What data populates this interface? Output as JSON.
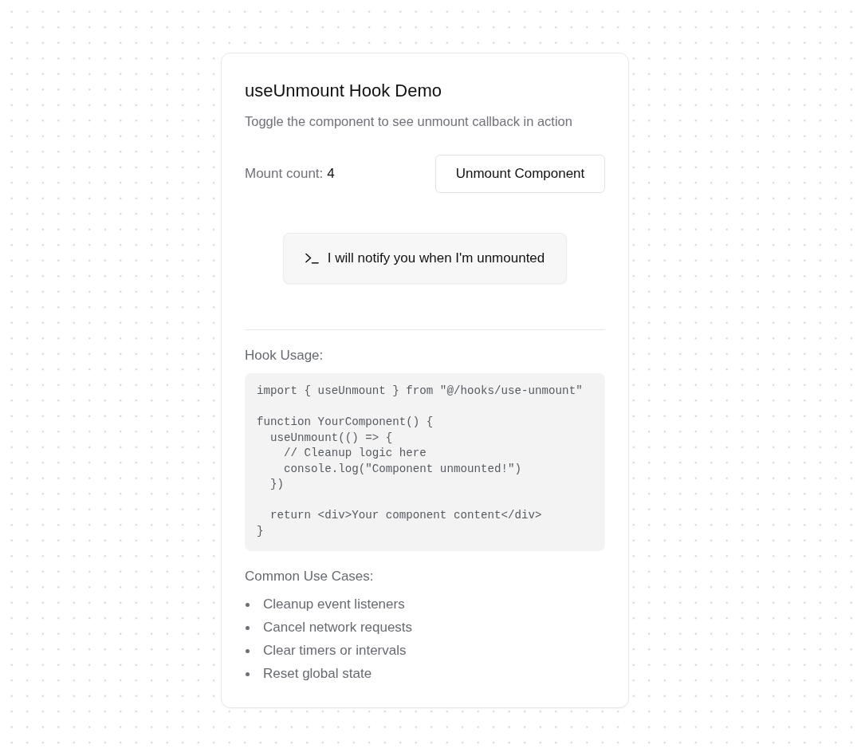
{
  "card": {
    "title": "useUnmount Hook Demo",
    "description": "Toggle the component to see unmount callback in action",
    "mount_count": {
      "label": "Mount count:",
      "value": "4"
    },
    "toggle_button": {
      "label": "Unmount Component"
    },
    "notice": {
      "text": "I will notify you when I'm unmounted"
    },
    "usage": {
      "heading": "Hook Usage:",
      "code": "import { useUnmount } from \"@/hooks/use-unmount\"\n\nfunction YourComponent() {\n  useUnmount(() => {\n    // Cleanup logic here\n    console.log(\"Component unmounted!\")\n  })\n\n  return <div>Your component content</div>\n}"
    },
    "use_cases": {
      "heading": "Common Use Cases:",
      "items": [
        "Cleanup event listeners",
        "Cancel network requests",
        "Clear timers or intervals",
        "Reset global state"
      ]
    }
  }
}
